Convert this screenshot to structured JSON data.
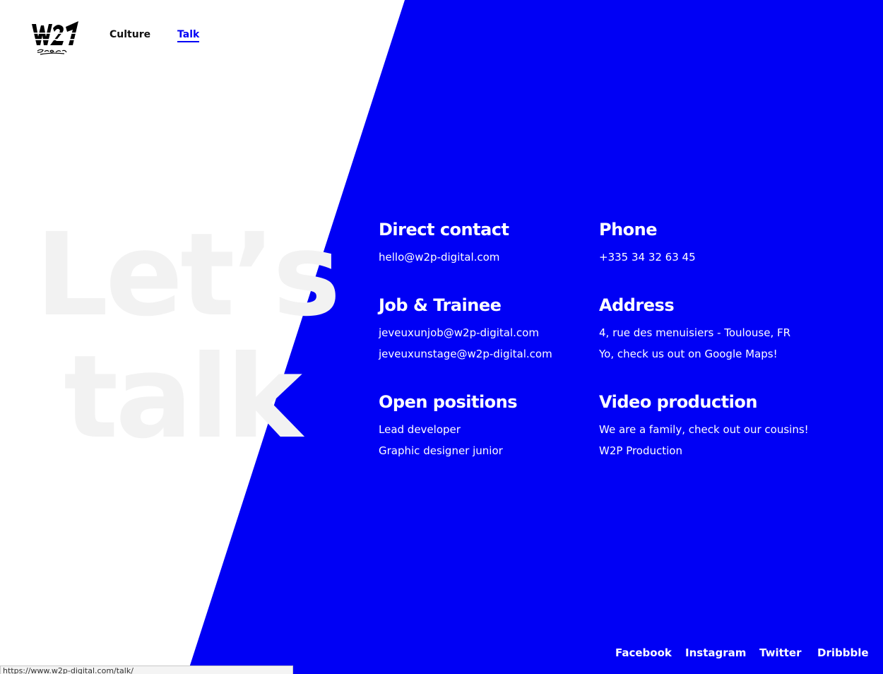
{
  "theme": {
    "accent": "#0000f5",
    "background": "#ffffff",
    "watermark_color": "#f2f2f2",
    "text_on_accent": "#ffffff"
  },
  "header": {
    "logo_text": "W2P Digital",
    "nav": [
      {
        "label": "Culture",
        "active": false
      },
      {
        "label": "Talk",
        "active": true
      }
    ]
  },
  "hero": {
    "watermark_lines": [
      "Let’s",
      "talk"
    ]
  },
  "contact": {
    "direct": {
      "heading": "Direct contact",
      "lines": [
        "hello@w2p-digital.com"
      ]
    },
    "phone": {
      "heading": "Phone",
      "lines": [
        "+335 34 32 63 45"
      ]
    },
    "jobs": {
      "heading": "Job & Trainee",
      "lines": [
        "jeveuxunjob@w2p-digital.com",
        "jeveuxunstage@w2p-digital.com"
      ]
    },
    "address": {
      "heading": "Address",
      "lines": [
        "4, rue des menuisiers - Toulouse, FR",
        "Yo, check us out on Google Maps!"
      ]
    },
    "positions": {
      "heading": "Open positions",
      "lines": [
        "Lead developer",
        "Graphic designer junior"
      ]
    },
    "video": {
      "heading": "Video production",
      "lines": [
        "We are a family, check out our cousins!",
        "W2P Production"
      ]
    }
  },
  "social": [
    "Facebook",
    "Instagram",
    "Twitter",
    "Dribbble"
  ],
  "status_bar": {
    "url": "https://www.w2p-digital.com/talk/"
  }
}
